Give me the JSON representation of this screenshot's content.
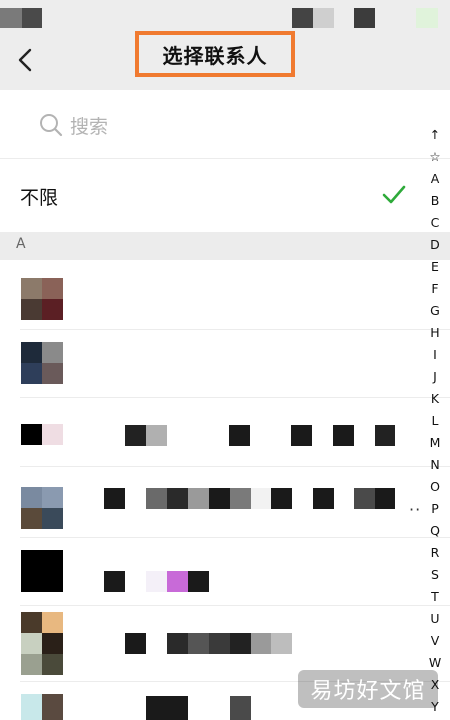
{
  "nav": {
    "title": "选择联系人"
  },
  "search": {
    "placeholder": "搜索"
  },
  "filter": {
    "label": "不限"
  },
  "section": {
    "letter": "A"
  },
  "alphabet": [
    "↑",
    "☆",
    "A",
    "B",
    "C",
    "D",
    "E",
    "F",
    "G",
    "H",
    "I",
    "J",
    "K",
    "L",
    "M",
    "N",
    "O",
    "P",
    "Q",
    "R",
    "S",
    "T",
    "U",
    "V",
    "W",
    "X",
    "Y"
  ],
  "watermark": "易坊好文馆",
  "colors": {
    "accent": "#f07a30",
    "check": "#2eaa3a",
    "background": "#ededed"
  }
}
